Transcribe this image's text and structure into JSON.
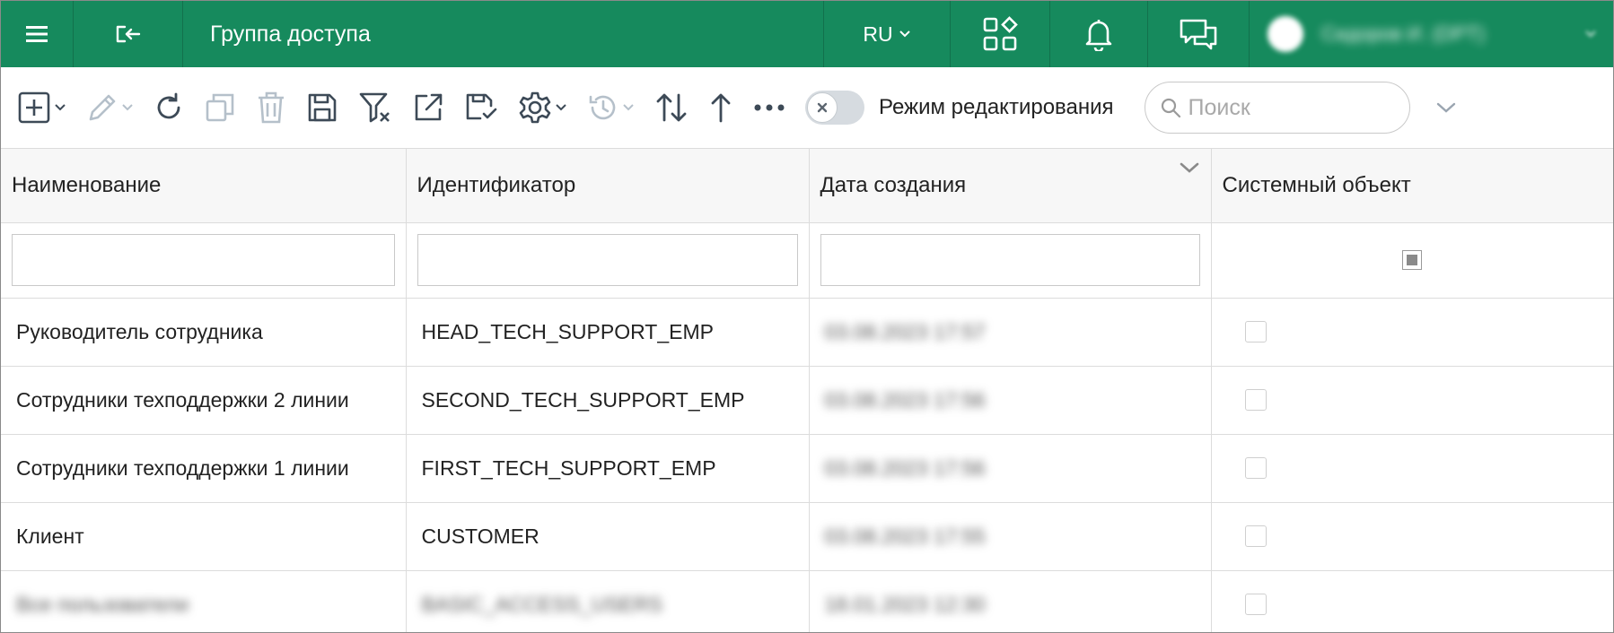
{
  "header": {
    "title": "Группа доступа",
    "language": "RU",
    "user_name": "Сидоров И. (DPT)"
  },
  "colors": {
    "brand": "#168a5d",
    "header_bg": "#f7f7f7",
    "border": "#dcdcdc"
  },
  "toolbar": {
    "icons": [
      "add-icon",
      "edit-icon",
      "refresh-icon",
      "copy-icon",
      "delete-icon",
      "save-icon",
      "filter-clear-icon",
      "export-icon",
      "save-settings-icon",
      "gear-icon",
      "history-icon",
      "sort-icon",
      "up-arrow-icon",
      "more-icon"
    ],
    "edit_mode_label": "Режим редактирования",
    "search_placeholder": "Поиск"
  },
  "table": {
    "columns": [
      "Наименование",
      "Идентификатор",
      "Дата создания",
      "Системный объект"
    ],
    "rows": [
      {
        "name": "Руководитель сотрудника",
        "id": "HEAD_TECH_SUPPORT_EMP",
        "date": "03.08.2023 17:57",
        "system": false
      },
      {
        "name": "Сотрудники техподдержки 2 линии",
        "id": "SECOND_TECH_SUPPORT_EMP",
        "date": "03.08.2023 17:56",
        "system": false
      },
      {
        "name": "Сотрудники техподдержки 1 линии",
        "id": "FIRST_TECH_SUPPORT_EMP",
        "date": "03.08.2023 17:56",
        "system": false
      },
      {
        "name": "Клиент",
        "id": "CUSTOMER",
        "date": "03.08.2023 17:55",
        "system": false
      },
      {
        "name": "Все пользователи",
        "id": "BASIC_ACCESS_USERS",
        "date": "18.01.2023 12:30",
        "system": false
      }
    ]
  }
}
